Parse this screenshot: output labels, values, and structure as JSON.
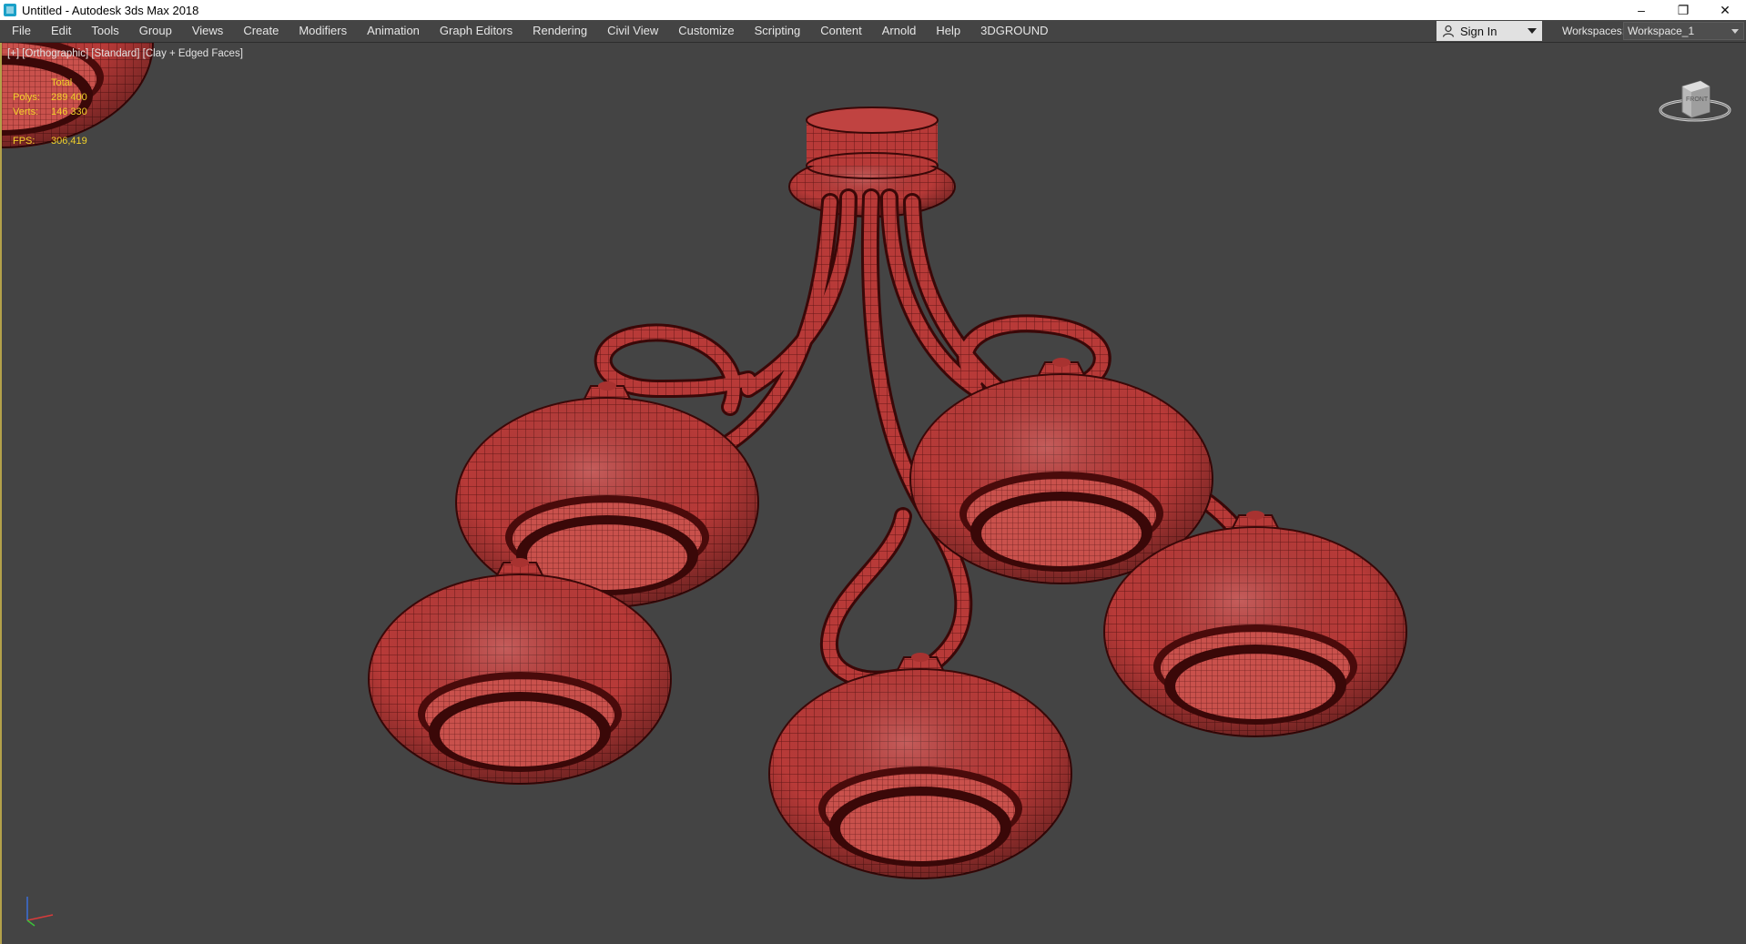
{
  "window": {
    "title": "Untitled - Autodesk 3ds Max 2018",
    "controls": {
      "minimize": "–",
      "restore": "❐",
      "close": "✕"
    }
  },
  "menu": {
    "items": [
      "File",
      "Edit",
      "Tools",
      "Group",
      "Views",
      "Create",
      "Modifiers",
      "Animation",
      "Graph Editors",
      "Rendering",
      "Civil View",
      "Customize",
      "Scripting",
      "Content",
      "Arnold",
      "Help",
      "3DGROUND"
    ]
  },
  "account": {
    "sign_in_label": "Sign In",
    "workspaces_label": "Workspaces:",
    "workspace_value": "Workspace_1"
  },
  "viewport": {
    "label": "[+] [Orthographic] [Standard] [Clay + Edged Faces]",
    "stats": {
      "header": "Total",
      "polys_label": "Polys:",
      "polys_value": "289 400",
      "verts_label": "Verts:",
      "verts_value": "146 330",
      "fps_label": "FPS:",
      "fps_value": "306,419"
    },
    "viewcube_label": "FRONT"
  },
  "colors": {
    "viewport_bg": "#444444",
    "mesh_fill": "#b83a38",
    "mesh_line": "#4a0b0b",
    "stats_text": "#f2d12a",
    "active_border": "#b3a14a"
  },
  "icons": {
    "app": "3dsmax-icon",
    "user": "user-icon",
    "viewcube": "viewcube-icon",
    "axis": "axis-tripod-icon"
  }
}
